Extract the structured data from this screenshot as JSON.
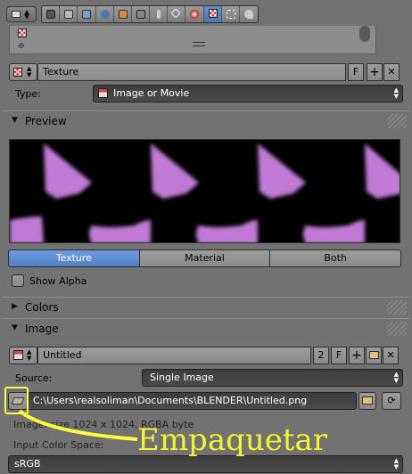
{
  "header": {
    "context_buttons": [
      "render-icon",
      "render-layers-icon",
      "scene-icon",
      "world-icon",
      "object-icon",
      "constraints-icon",
      "modifiers-icon",
      "data-icon",
      "material-icon",
      "texture-icon",
      "particles-icon",
      "physics-icon"
    ],
    "active_context": "texture-icon"
  },
  "texture_block": {
    "name": "Texture",
    "fake_user": "F",
    "add": "+",
    "remove": "✕"
  },
  "type_row": {
    "label": "Type:",
    "value": "Image or Movie"
  },
  "panels": {
    "preview": "Preview",
    "colors": "Colors",
    "image": "Image"
  },
  "preview_toggle": {
    "options": [
      "Texture",
      "Material",
      "Both"
    ],
    "selected": "Texture"
  },
  "show_alpha": "Show Alpha",
  "image_block": {
    "name": "Untitled",
    "users": "2",
    "fake_user": "F"
  },
  "source_row": {
    "label": "Source:",
    "value": "Single Image"
  },
  "filepath": "C:\\Users\\realsoliman\\Documents\\BLENDER\\Untitled.png",
  "image_info": "Image: size 1024 x 1024, RGBA byte",
  "input_color_space": {
    "label": "Input Color Space:",
    "value": "sRGB"
  },
  "annotation": "Empaquetar",
  "colors": {
    "selected_tab": "#5a8ad0",
    "annotation": "#f5f52e",
    "preview_texture": "#c07ad6"
  }
}
